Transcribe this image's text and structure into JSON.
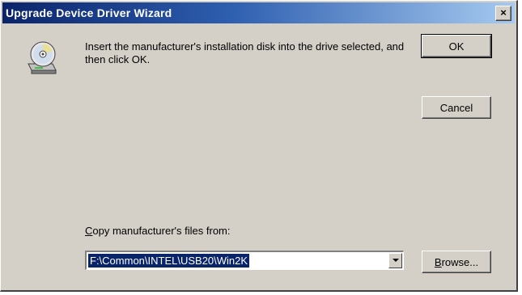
{
  "window": {
    "title": "Upgrade Device Driver Wizard",
    "close_glyph": "×"
  },
  "message": "Insert the manufacturer's installation disk into the drive selected, and then click OK.",
  "buttons": {
    "ok": "OK",
    "cancel": "Cancel",
    "browse_mnemonic": "B",
    "browse_rest": "rowse..."
  },
  "copy_from": {
    "label_mnemonic": "C",
    "label_rest": "opy manufacturer's files from:",
    "value": "F:\\Common\\INTEL\\USB20\\Win2K"
  },
  "icons": {
    "disk": "cd-install-icon",
    "dropdown": "chevron-down-icon",
    "close": "close-icon"
  },
  "colors": {
    "title_bar": "#0a246a",
    "dialog_face": "#d4d0c8",
    "selection": "#0a246a"
  }
}
